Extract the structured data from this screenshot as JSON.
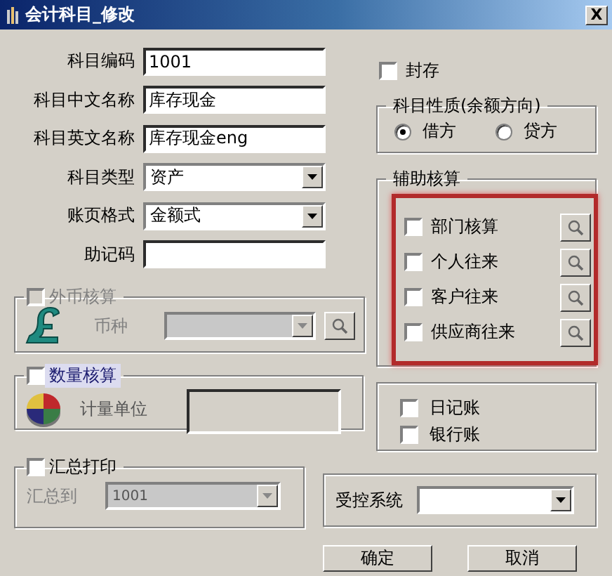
{
  "window": {
    "title": "会计科目_修改",
    "close": "X"
  },
  "fields": [
    {
      "label": "科目编码",
      "value": "1001",
      "kind": "text"
    },
    {
      "label": "科目中文名称",
      "value": "库存现金",
      "kind": "text"
    },
    {
      "label": "科目英文名称",
      "value": "库存现金eng",
      "kind": "text"
    },
    {
      "label": "科目类型",
      "value": "资产",
      "kind": "select"
    },
    {
      "label": "账页格式",
      "value": "金额式",
      "kind": "select"
    },
    {
      "label": "助记码",
      "kind": "text"
    }
  ],
  "sealed": {
    "label": "封存",
    "checked": false
  },
  "balance_direction": {
    "title": "科目性质(余额方向)",
    "options": [
      {
        "label": "借方",
        "selected": true
      },
      {
        "label": "贷方",
        "selected": false
      }
    ]
  },
  "auxiliary": {
    "title": "辅助核算",
    "highlighted": true,
    "items": [
      {
        "label": "部门核算",
        "checked": false
      },
      {
        "label": "个人往来",
        "checked": false
      },
      {
        "label": "客户往来",
        "checked": false
      },
      {
        "label": "供应商往来",
        "checked": false
      }
    ]
  },
  "foreign_currency": {
    "label": "外币核算",
    "checked": false,
    "disabled": true,
    "currency_label": "币种"
  },
  "quantity": {
    "label": "数量核算",
    "checked": false,
    "focused": true,
    "unit_label": "计量单位"
  },
  "summary_print": {
    "label": "汇总打印",
    "checked": false,
    "target_label": "汇总到",
    "target_value": "1001",
    "disabled": true
  },
  "ledgers": [
    {
      "label": "日记账",
      "checked": false
    },
    {
      "label": "银行账",
      "checked": false
    }
  ],
  "controlled_system": {
    "label": "受控系统"
  },
  "buttons": [
    "确定",
    "取消"
  ]
}
